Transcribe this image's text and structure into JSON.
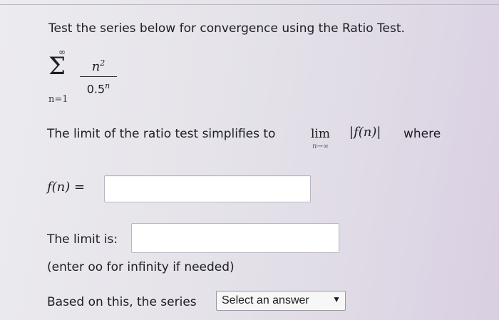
{
  "question": {
    "prompt": "Test the series below for convergence using the Ratio Test.",
    "series": {
      "sum_upper": "∞",
      "sum_symbol": "Σ",
      "sum_lower": "n=1",
      "numerator_base": "n",
      "numerator_exp": "2",
      "denominator_base": "0.5",
      "denominator_exp": "n"
    },
    "limit_text": "The limit of the ratio test simplifies to",
    "lim_word": "lim",
    "lim_sub": "n→∞",
    "abs_expr": "f(n)",
    "where_text": "where",
    "fn_label": "f(n) =",
    "fn_input_value": "",
    "limit_label": "The limit is:",
    "limit_input_value": "",
    "hint": "(enter oo for infinity if needed)",
    "based_text": "Based on this, the series",
    "select_value": "Select an answer",
    "chevron_icon": "chevron-down-icon"
  }
}
